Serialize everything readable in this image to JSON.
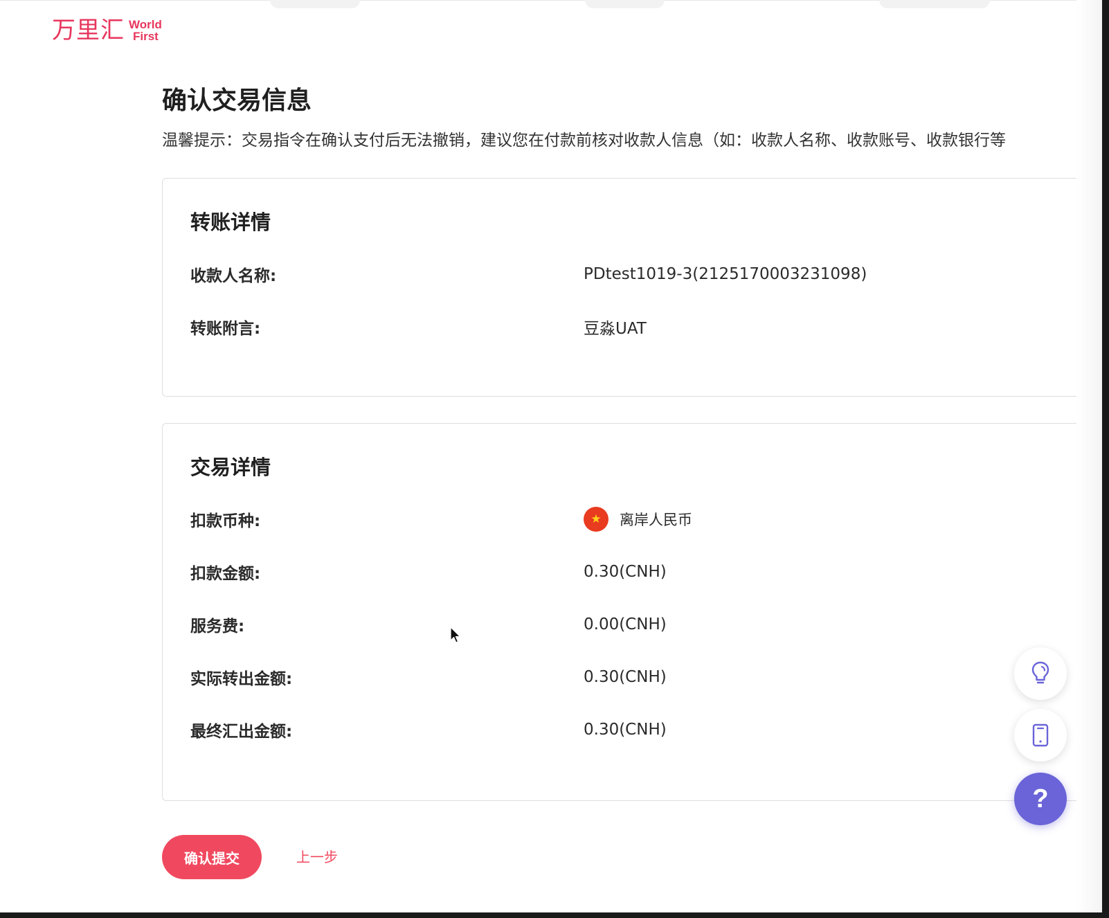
{
  "brand": {
    "logo_cn": "万里汇",
    "logo_en_line1": "World",
    "logo_en_line2": "First"
  },
  "page": {
    "title": "确认交易信息",
    "tip": "温馨提示：交易指令在确认支付后无法撤销，建议您在付款前核对收款人信息（如：收款人名称、收款账号、收款银行等"
  },
  "transfer_details": {
    "title": "转账详情",
    "rows": [
      {
        "label": "收款人名称:",
        "value": "PDtest1019-3(2125170003231098)"
      },
      {
        "label": "转账附言:",
        "value": "豆淼UAT"
      }
    ]
  },
  "transaction_details": {
    "title": "交易详情",
    "currency_label": "扣款币种:",
    "currency_value": "离岸人民币",
    "currency_flag_icon": "china-flag-icon",
    "rows": [
      {
        "label": "扣款金额:",
        "value": "0.30(CNH)"
      },
      {
        "label": "服务费:",
        "value": "0.00(CNH)"
      },
      {
        "label": "实际转出金额:",
        "value": "0.30(CNH)"
      },
      {
        "label": "最终汇出金额:",
        "value": "0.30(CNH)"
      }
    ]
  },
  "actions": {
    "confirm_label": "确认提交",
    "back_label": "上一步"
  },
  "floating": {
    "help_label": "?"
  },
  "colors": {
    "brand": "#e8365d",
    "primary_button": "#f0495f",
    "help_fab": "#6a64d8"
  }
}
